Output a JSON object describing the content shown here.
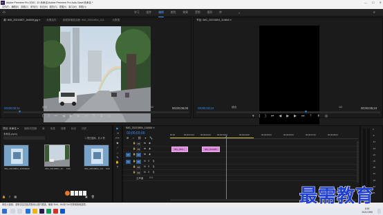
{
  "window": {
    "app_badge": "Pr",
    "title": "Adobe Premiere Pro 2020 - D:\\未命名\\Adobe Premiere Pro Auto-Save\\未命名 *",
    "min": "—",
    "max": "☐",
    "close": "✕"
  },
  "menu": [
    "文件(F)",
    "编辑(E)",
    "剪辑(C)",
    "序列(S)",
    "标记(M)",
    "图形(G)",
    "视图(V)",
    "窗口(W)",
    "帮助(H)"
  ],
  "workspace": {
    "tabs": [
      "学习",
      "组件",
      "编辑",
      "颜色",
      "效果",
      "音频",
      "图形",
      "库"
    ],
    "active_index": 2,
    "more": "»"
  },
  "source_monitor": {
    "tabs": [
      "源: IMG_20210807_164654.jpg ≡",
      "效果控件",
      "音频剪辑混合器: IMG_20210804_114...",
      "元数据"
    ],
    "timecode_in": "00;00;00;11",
    "fit": "适合",
    "ratio": "1/2",
    "timecode_out": "00;00;05;00"
  },
  "program_monitor": {
    "tab": "节目: IMG_20210804_114844 ≡",
    "timecode_in": "00;00;03;24",
    "fit": "适合",
    "ratio": "1/2",
    "timecode_out": "00;00;05;24"
  },
  "project": {
    "tabs": [
      "项目: 未命名 ≡",
      "媒体浏览器",
      "库",
      "信息",
      "效果",
      "标记",
      "历史"
    ],
    "project_file": "未命名.prproj",
    "item_count": "1 项已选择，共 4 项",
    "items": [
      {
        "name": "IMG_20210804_114844...",
        "dur": "5;00"
      },
      {
        "name": "IMG_20210807_16...",
        "dur": "5;00"
      },
      {
        "name": "IMG_20210804_114...",
        "dur": "5;00"
      }
    ]
  },
  "tools": [
    "▶",
    "⇥",
    "⟷",
    "◆",
    "⟋",
    "↔",
    "✎",
    "✋",
    "T"
  ],
  "timeline": {
    "tab": "IMG_20210804_114844 ≡",
    "timecode": "00;00;03;09",
    "ruler": [
      "00;00",
      "00;00;01;00",
      "00;00;02;00",
      "00;00;03;00",
      "00;00;04;00",
      "00;00;05;00",
      "00;00;06;00",
      "00;00;07;00",
      "00;00;08;00"
    ],
    "video_tracks": [
      "V3",
      "V2",
      "V1"
    ],
    "audio_tracks": [
      "A1",
      "A2",
      "A3"
    ],
    "master_label": "主声道",
    "master_value": "0.0",
    "clips": [
      {
        "label": "IMG_2021..."
      },
      {
        "label": "IMG_2021080..."
      }
    ]
  },
  "meters": {
    "scale": [
      "0",
      "-6",
      "-12",
      "-18",
      "-24",
      "-30",
      "-36",
      "-42",
      "-48",
      "-54",
      "dB"
    ],
    "solo": "S S"
  },
  "status_text": "单击以选择，或单击空白处并拖动以进行框选。使用 Shift、Alt 和 Ctrl 可获得其他选项。",
  "taskbar": {
    "time": "8:52",
    "date": "2021/7/8/8"
  },
  "watermark": "最需教育",
  "colors": {
    "accent": "#4aa3ff",
    "timecode": "#3b8ff0",
    "clip": "#d98ad9",
    "track_label": "#2e5f9a"
  }
}
